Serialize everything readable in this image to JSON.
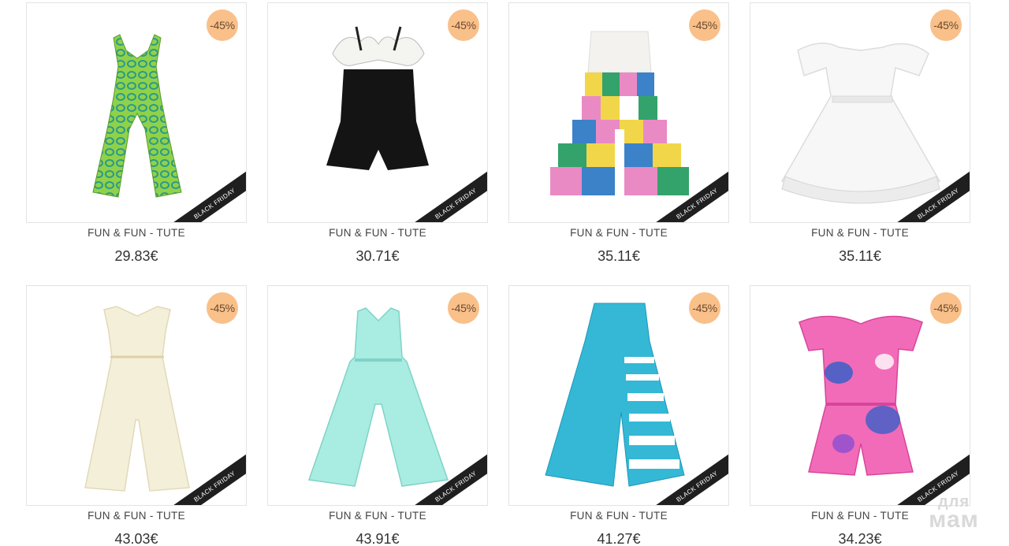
{
  "products": [
    {
      "brand": "FUN & FUN - TUTE",
      "price": "29.83€",
      "discount": "-45%",
      "ribbon": "BLACK FRIDAY",
      "item": "green-snake-print-jumpsuit"
    },
    {
      "brand": "FUN & FUN - TUTE",
      "price": "30.71€",
      "discount": "-45%",
      "ribbon": "BLACK FRIDAY",
      "item": "black-ruffle-playsuit"
    },
    {
      "brand": "FUN & FUN - TUTE",
      "price": "35.11€",
      "discount": "-45%",
      "ribbon": "BLACK FRIDAY",
      "item": "colorblock-pleated-jumpsuit"
    },
    {
      "brand": "FUN & FUN - TUTE",
      "price": "35.11€",
      "discount": "-45%",
      "ribbon": "BLACK FRIDAY",
      "item": "white-tulle-dress"
    },
    {
      "brand": "FUN & FUN - TUTE",
      "price": "43.03€",
      "discount": "-45%",
      "ribbon": "BLACK FRIDAY",
      "item": "cream-sheer-jumpsuit"
    },
    {
      "brand": "FUN & FUN - TUTE",
      "price": "43.91€",
      "discount": "-45%",
      "ribbon": "BLACK FRIDAY",
      "item": "mint-wide-leg-jumpsuit"
    },
    {
      "brand": "FUN & FUN - TUTE",
      "price": "41.27€",
      "discount": "-45%",
      "ribbon": "BLACK FRIDAY",
      "item": "turquoise-pleated-jumpsuit"
    },
    {
      "brand": "FUN & FUN - TUTE",
      "price": "34.23€",
      "discount": "-45%",
      "ribbon": "BLACK FRIDAY",
      "item": "pink-floral-romper"
    }
  ],
  "watermark": {
    "line1": "для",
    "line2": "мам"
  },
  "colors": {
    "badge": "#f9c08a",
    "ribbon": "#1f1f1f",
    "border": "#e3e3e3"
  }
}
